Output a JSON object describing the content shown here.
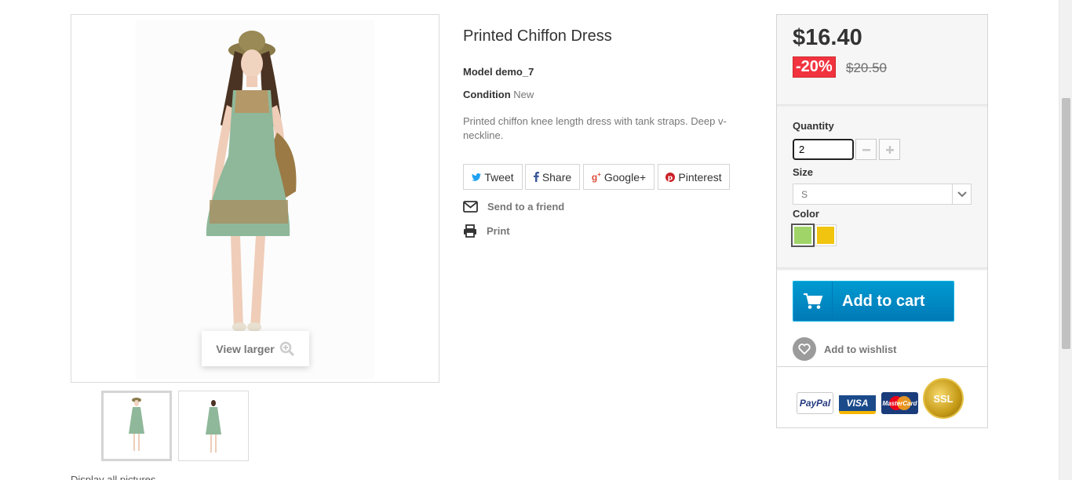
{
  "product": {
    "name": "Printed Chiffon Dress",
    "model_label": "Model",
    "model_value": "demo_7",
    "condition_label": "Condition",
    "condition_value": "New",
    "short_description": "Printed chiffon knee length dress with tank straps. Deep v-neckline."
  },
  "gallery": {
    "view_larger": "View larger",
    "thumbnails": [
      "front",
      "side"
    ],
    "bottom_link": "Display all pictures"
  },
  "social": {
    "tweet": "Tweet",
    "share": "Share",
    "google": "Google+",
    "pinterest": "Pinterest"
  },
  "extra_links": {
    "send_to_friend": "Send to a friend",
    "print": "Print"
  },
  "buy_box": {
    "price": "$16.40",
    "discount": "-20%",
    "old_price": "$20.50",
    "quantity_label": "Quantity",
    "quantity_value": "2",
    "size_label": "Size",
    "size_selected": "S",
    "color_label": "Color",
    "colors": [
      {
        "name": "Green",
        "hex": "#a0d468",
        "selected": true
      },
      {
        "name": "Yellow",
        "hex": "#f1c40f",
        "selected": false
      }
    ],
    "add_to_cart": "Add to cart",
    "add_to_wishlist": "Add to wishlist",
    "payment_logos": [
      "PayPal",
      "VISA",
      "MasterCard",
      "SSL"
    ]
  },
  "colors": {
    "accent_blue": "#009ad0",
    "discount_red": "#f13340"
  }
}
